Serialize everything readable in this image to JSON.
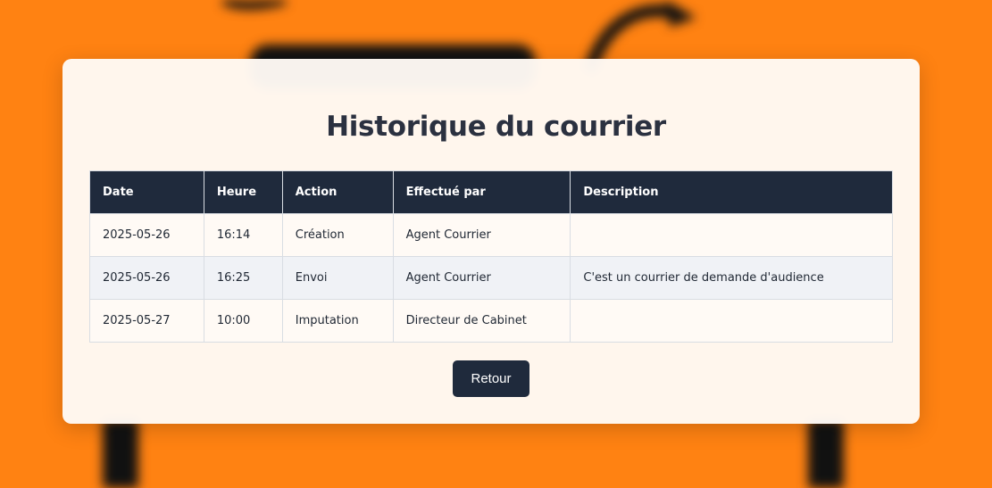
{
  "page": {
    "title": "Historique du courrier"
  },
  "table": {
    "headers": [
      "Date",
      "Heure",
      "Action",
      "Effectué par",
      "Description"
    ],
    "rows": [
      [
        "2025-05-26",
        "16:14",
        "Création",
        "Agent Courrier",
        ""
      ],
      [
        "2025-05-26",
        "16:25",
        "Envoi",
        "Agent Courrier",
        "C'est un courrier de demande d'audience"
      ],
      [
        "2025-05-27",
        "10:00",
        "Imputation",
        "Directeur de Cabinet",
        ""
      ]
    ]
  },
  "actions": {
    "back_label": "Retour"
  },
  "colors": {
    "background": "#ff8212",
    "header": "#1f2a3c",
    "card": "#fffaf5",
    "stripe": "#f0f2f6",
    "title": "#2b3140"
  }
}
